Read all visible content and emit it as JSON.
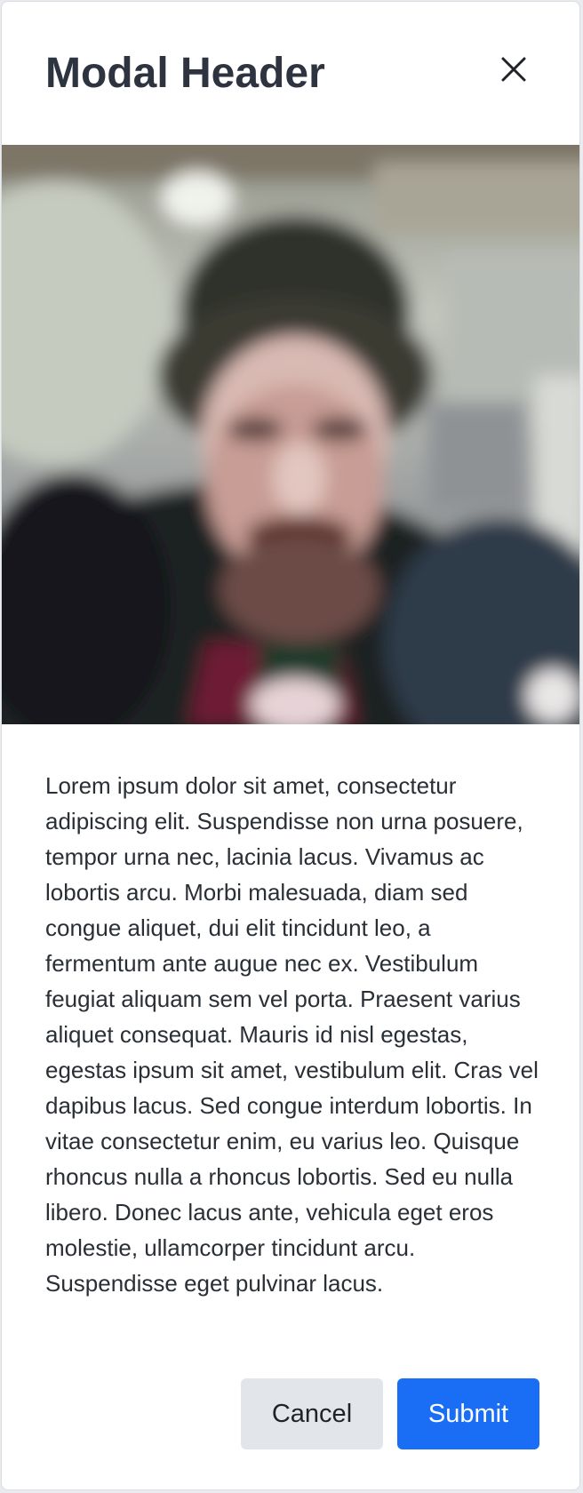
{
  "modal": {
    "title": "Modal Header",
    "close_icon": "close-icon",
    "image": {
      "description_icon": "photo"
    },
    "body_text": "Lorem ipsum dolor sit amet, consectetur adipiscing elit. Suspendisse non urna posuere, tempor urna nec, lacinia lacus. Vivamus ac lobortis arcu. Morbi malesuada, diam sed congue aliquet, dui elit tincidunt leo, a fermentum ante augue nec ex. Vestibulum feugiat aliquam sem vel porta. Praesent varius aliquet consequat. Mauris id nisl egestas, egestas ipsum sit amet, vestibulum elit. Cras vel dapibus lacus. Sed congue interdum lobortis. In vitae consectetur enim, eu varius leo. Quisque rhoncus nulla a rhoncus lobortis. Sed eu nulla libero. Donec lacus ante, vehicula eget eros molestie, ullamcorper tincidunt arcu. Suspendisse eget pulvinar lacus.",
    "buttons": {
      "cancel_label": "Cancel",
      "submit_label": "Submit"
    }
  },
  "colors": {
    "primary": "#1a6ef5",
    "secondary": "#e2e6ea",
    "title_text": "#2d3440",
    "body_text": "#2a2f36"
  }
}
